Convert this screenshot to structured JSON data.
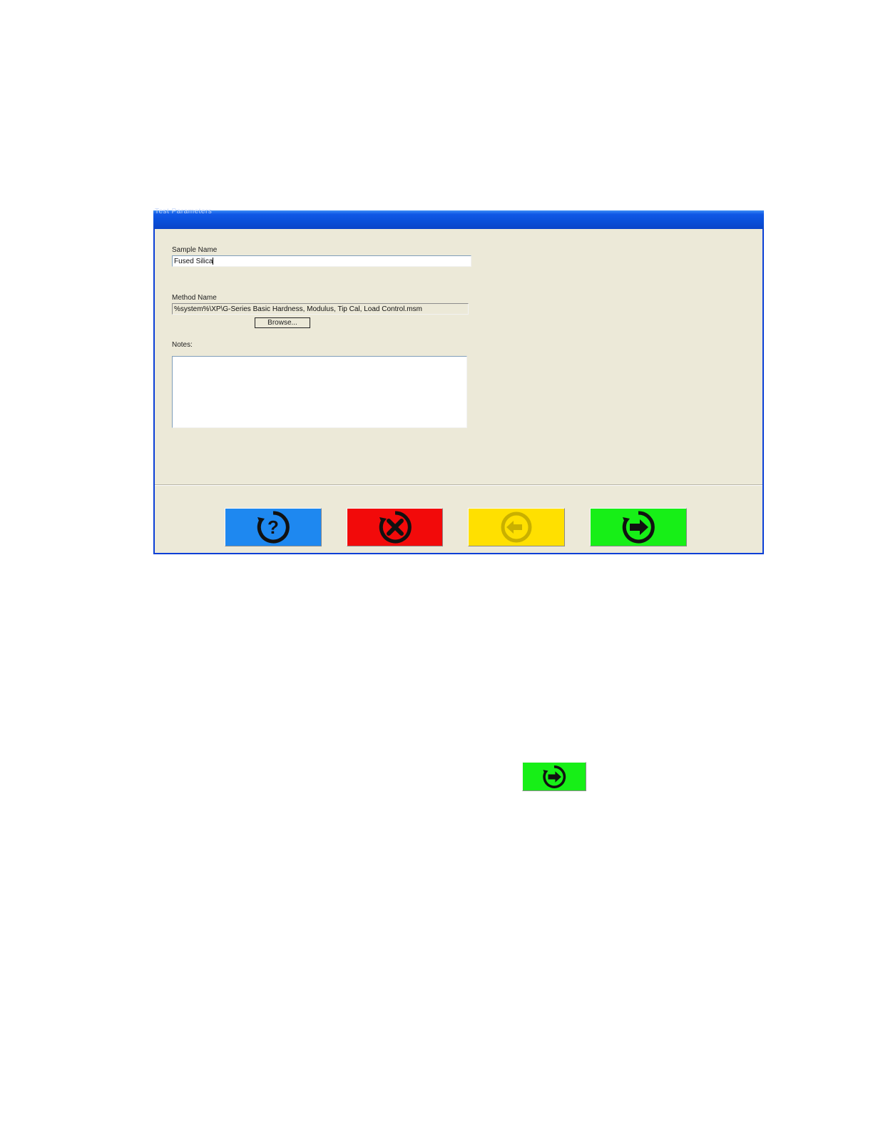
{
  "window": {
    "title": "Test Parameters"
  },
  "form": {
    "sample_name_label": "Sample Name",
    "sample_name_value": "Fused Silica",
    "method_name_label": "Method Name",
    "method_name_value": "%system%\\XP\\G-Series Basic Hardness, Modulus, Tip Cal, Load Control.msm",
    "browse_label": "Browse...",
    "notes_label": "Notes:",
    "notes_value": ""
  },
  "buttons": [
    {
      "name": "help",
      "icon": "question-icon",
      "color": "#1e88f0"
    },
    {
      "name": "cancel",
      "icon": "x-icon",
      "color": "#f20a0a"
    },
    {
      "name": "back",
      "icon": "back-arrow-icon",
      "color": "#ffe000"
    },
    {
      "name": "next",
      "icon": "right-arrow-icon",
      "color": "#17ef17"
    }
  ],
  "inline_icon": {
    "icon": "right-arrow-icon",
    "color": "#17ef17"
  }
}
